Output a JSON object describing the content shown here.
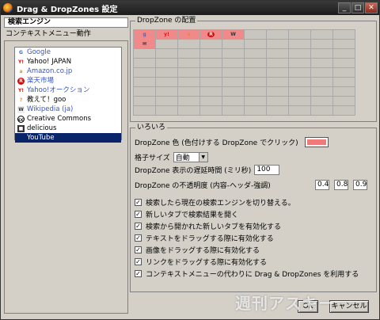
{
  "window": {
    "title": "Drag & DropZones 設定"
  },
  "left": {
    "tab_label": "検索エンジン",
    "sub_label": "コンテキストメニュー動作",
    "engines": [
      {
        "label": "Google",
        "color": "#3355cc",
        "icon": "g"
      },
      {
        "label": "Yahoo! JAPAN",
        "color": "#000000",
        "icon": "y"
      },
      {
        "label": "Amazon.co.jp",
        "color": "#3355cc",
        "icon": "a"
      },
      {
        "label": "楽天市場",
        "color": "#3355cc",
        "icon": "r"
      },
      {
        "label": "Yahoo!オークション",
        "color": "#3355cc",
        "icon": "y"
      },
      {
        "label": "教えて！goo",
        "color": "#000000",
        "icon": "q"
      },
      {
        "label": "Wikipedia (ja)",
        "color": "#3355cc",
        "icon": "w"
      },
      {
        "label": "Creative Commons",
        "color": "#000000",
        "icon": "cc"
      },
      {
        "label": "delicious",
        "color": "#000000",
        "icon": "d"
      },
      {
        "label": "YouTube",
        "color": "#ffffff",
        "icon": ""
      }
    ]
  },
  "dropzone": {
    "group_label": "DropZone の配置",
    "row1": [
      "g",
      "y!",
      "a",
      "R",
      "W"
    ],
    "row2": [
      "✉"
    ]
  },
  "misc": {
    "group_label": "いろいろ",
    "color_label": "DropZone 色 (色付けする DropZone でクリック)",
    "grid_size_label": "格子サイズ",
    "grid_size_value": "自動",
    "delay_label": "DropZone 表示の遅延時間 (ミリ秒)",
    "delay_value": "100",
    "opacity_label": "DropZone の不透明度 (内容-ヘッダ-強調)",
    "opacity_values": [
      "0.4",
      "0.8",
      "0.9"
    ],
    "checkboxes": [
      "検索したら現在の検索エンジンを切り替える。",
      "新しいタブで検索結果を開く",
      "検索から開かれた新しいタブを有効化する",
      "テキストをドラッグする際に有効化する",
      "画像をドラッグする際に有効化する",
      "リンクをドラッグする際に有効化する",
      "コンテキストメニューの代わりに Drag & DropZones を利用する"
    ]
  },
  "buttons": {
    "ok": "OK",
    "cancel": "キャンセル"
  },
  "watermark": "週刊アスキー"
}
